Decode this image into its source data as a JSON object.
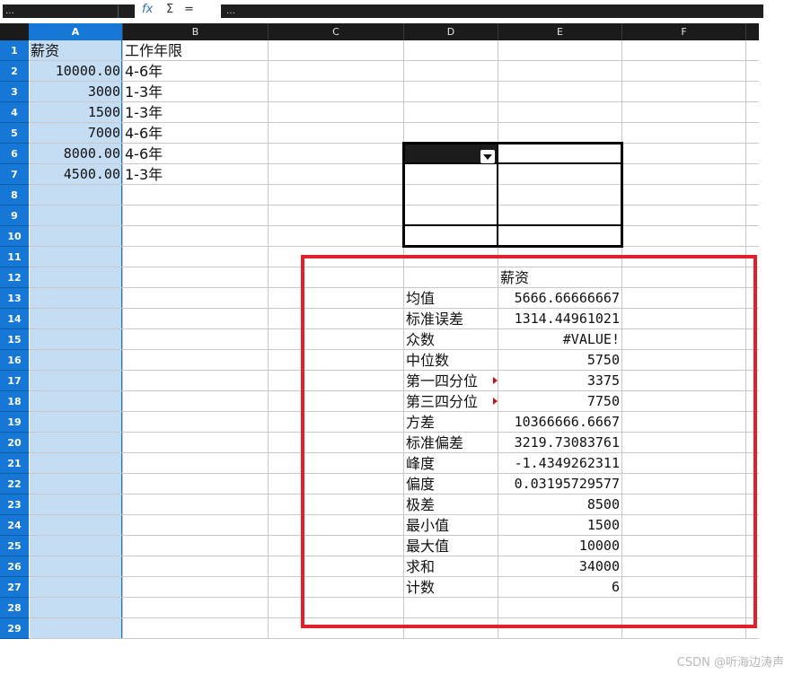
{
  "formula_bar": {
    "name_box": "…",
    "fx_symbol": "fx",
    "sum_symbol": "Σ",
    "equals_symbol": "=",
    "formula_text": "…"
  },
  "columns": [
    "A",
    "B",
    "C",
    "D",
    "E",
    "F"
  ],
  "rows": [
    "1",
    "2",
    "3",
    "4",
    "5",
    "6",
    "7",
    "8",
    "9",
    "10",
    "11",
    "12",
    "13",
    "14",
    "15",
    "16",
    "17",
    "18",
    "19",
    "20",
    "21",
    "22",
    "23",
    "24",
    "25",
    "26",
    "27",
    "28",
    "29"
  ],
  "data_columns": {
    "A": {
      "header": "薪资",
      "values": [
        "10000.00",
        "3000",
        "1500",
        "7000",
        "8000.00",
        "4500.00"
      ]
    },
    "B": {
      "header": "工作年限",
      "values": [
        "4-6年",
        "1-3年",
        "1-3年",
        "4-6年",
        "4-6年",
        "1-3年"
      ]
    }
  },
  "stats": {
    "header": "薪资",
    "rows": [
      {
        "label": "均值",
        "value": "5666.66666667"
      },
      {
        "label": "标准误差",
        "value": "1314.44961021"
      },
      {
        "label": "众数",
        "value": "#VALUE!"
      },
      {
        "label": "中位数",
        "value": "5750"
      },
      {
        "label": "第一四分位",
        "value": "3375"
      },
      {
        "label": "第三四分位",
        "value": "7750"
      },
      {
        "label": "方差",
        "value": "10366666.6667"
      },
      {
        "label": "标准偏差",
        "value": "3219.73083761"
      },
      {
        "label": "峰度",
        "value": "-1.4349262311"
      },
      {
        "label": "偏度",
        "value": "0.03195729577"
      },
      {
        "label": "极差",
        "value": "8500"
      },
      {
        "label": "最小值",
        "value": "1500"
      },
      {
        "label": "最大值",
        "value": "10000"
      },
      {
        "label": "求和",
        "value": "34000"
      },
      {
        "label": "计数",
        "value": "6"
      }
    ]
  },
  "watermark": "CSDN @听海边涛声",
  "colors": {
    "selection": "#1677d7",
    "selected_column_fill": "#c5ddf3",
    "highlight_border": "#e0202a",
    "header_dark": "#1b1b1b",
    "gridline": "#c8c8c8"
  },
  "icons": {
    "dropdown": "chevron-down-icon",
    "overflow": "text-overflow-marker-icon"
  }
}
